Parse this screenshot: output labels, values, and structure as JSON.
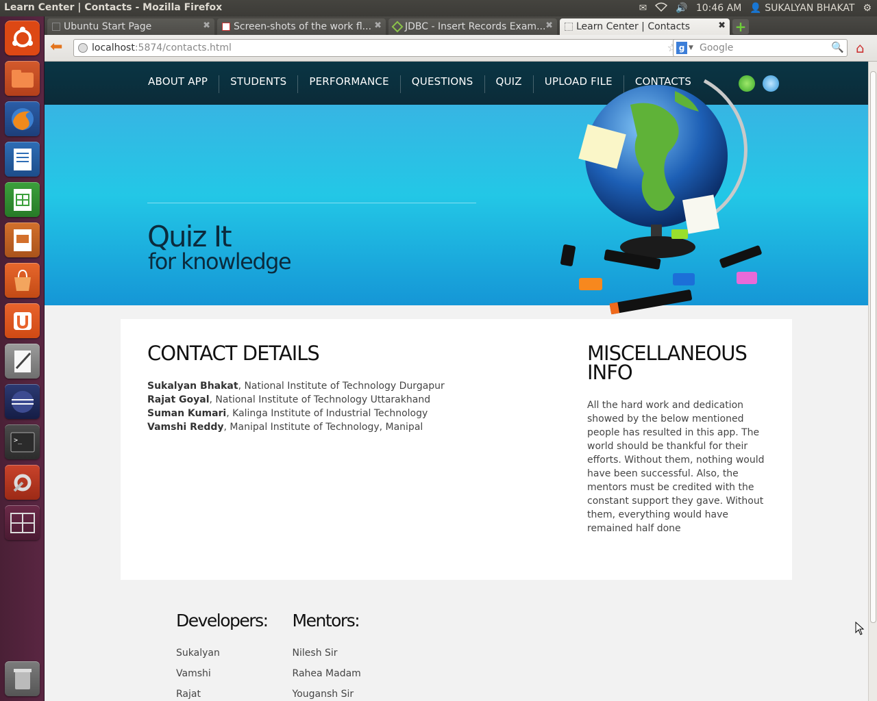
{
  "window": {
    "title": "Learn Center | Contacts - Mozilla Firefox",
    "time": "10:46 AM",
    "user": "SUKALYAN BHAKAT"
  },
  "tabs": [
    {
      "label": "Ubuntu Start Page"
    },
    {
      "label": "Screen-shots of the work fl..."
    },
    {
      "label": "JDBC - Insert Records Exam..."
    },
    {
      "label": "Learn Center | Contacts"
    }
  ],
  "url": {
    "host": "localhost",
    "path": ":5874/contacts.html"
  },
  "search": {
    "placeholder": "Google"
  },
  "menu": [
    "ABOUT APP",
    "STUDENTS",
    "PERFORMANCE",
    "QUESTIONS",
    "QUIZ",
    "UPLOAD FILE",
    "CONTACTS"
  ],
  "banner": {
    "slogan_line1": "Quiz It",
    "slogan_line2": "for knowledge"
  },
  "contact": {
    "heading": "CONTACT DETAILS",
    "people": [
      {
        "name": "Sukalyan Bhakat",
        "inst": ", National Institute of Technology Durgapur"
      },
      {
        "name": "Rajat Goyal",
        "inst": ", National Institute of Technology Uttarakhand"
      },
      {
        "name": "Suman Kumari",
        "inst": ", Kalinga Institute of Industrial Technology"
      },
      {
        "name": "Vamshi Reddy",
        "inst": ", Manipal Institute of Technology, Manipal"
      }
    ]
  },
  "misc": {
    "heading1": "MISCELLANEOUS",
    "heading2": "INFO",
    "text": "All the hard work and dedication showed by the below mentioned people has resulted in this app. The world should be thankful for their efforts. Without them, nothing would have been successful. Also, the mentors must be credited with the constant support they gave. Without them, everything would have remained half done"
  },
  "developers": {
    "heading": "Developers:",
    "names": [
      "Sukalyan",
      "Vamshi",
      "Rajat"
    ]
  },
  "mentors": {
    "heading": "Mentors:",
    "names": [
      "Nilesh Sir",
      "Rahea Madam",
      "Yougansh Sir"
    ]
  },
  "colors": {
    "header": "#0b2b38",
    "banner": "#23c7e6",
    "launcher": "#5a2642"
  }
}
